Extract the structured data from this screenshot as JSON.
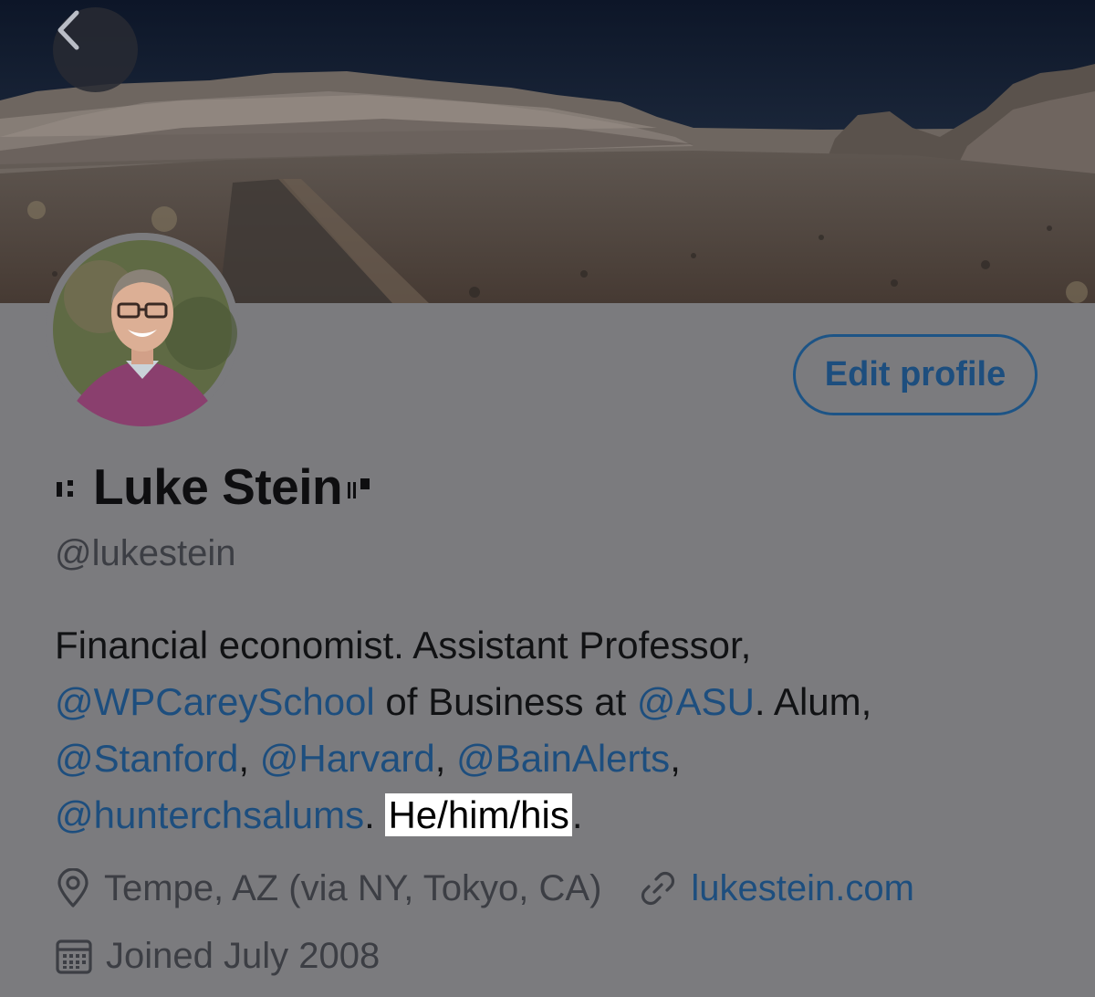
{
  "header": {
    "back_icon": "chevron-left-icon"
  },
  "profile": {
    "display_name": "Luke Stein",
    "handle": "@lukestein",
    "edit_profile_label": "Edit profile",
    "bio": {
      "line1": "Financial economist. Assistant Professor,",
      "mention_wpcarey": "@WPCareySchool",
      "text_of_business": " of Business at ",
      "mention_asu": "@ASU",
      "text_alum": ". Alum,",
      "mention_stanford": "@Stanford",
      "comma1": ", ",
      "mention_harvard": "@Harvard",
      "comma2": ", ",
      "mention_bain": "@BainAlerts",
      "comma3": ",",
      "mention_hunter": "@hunterchsalums",
      "period1": ". ",
      "pronouns": "He/him/his",
      "period2": "."
    },
    "location": "Tempe, AZ (via NY, Tokyo, CA)",
    "location_icon": "location-pin-icon",
    "website": "lukestein.com",
    "website_icon": "link-icon",
    "joined": "Joined July 2008",
    "joined_icon": "calendar-icon"
  },
  "colors": {
    "background": "#7b7b7e",
    "accent": "#1d4e7e",
    "text": "#111214",
    "secondary_text": "#3c3e44",
    "highlight": "#ffffff"
  }
}
